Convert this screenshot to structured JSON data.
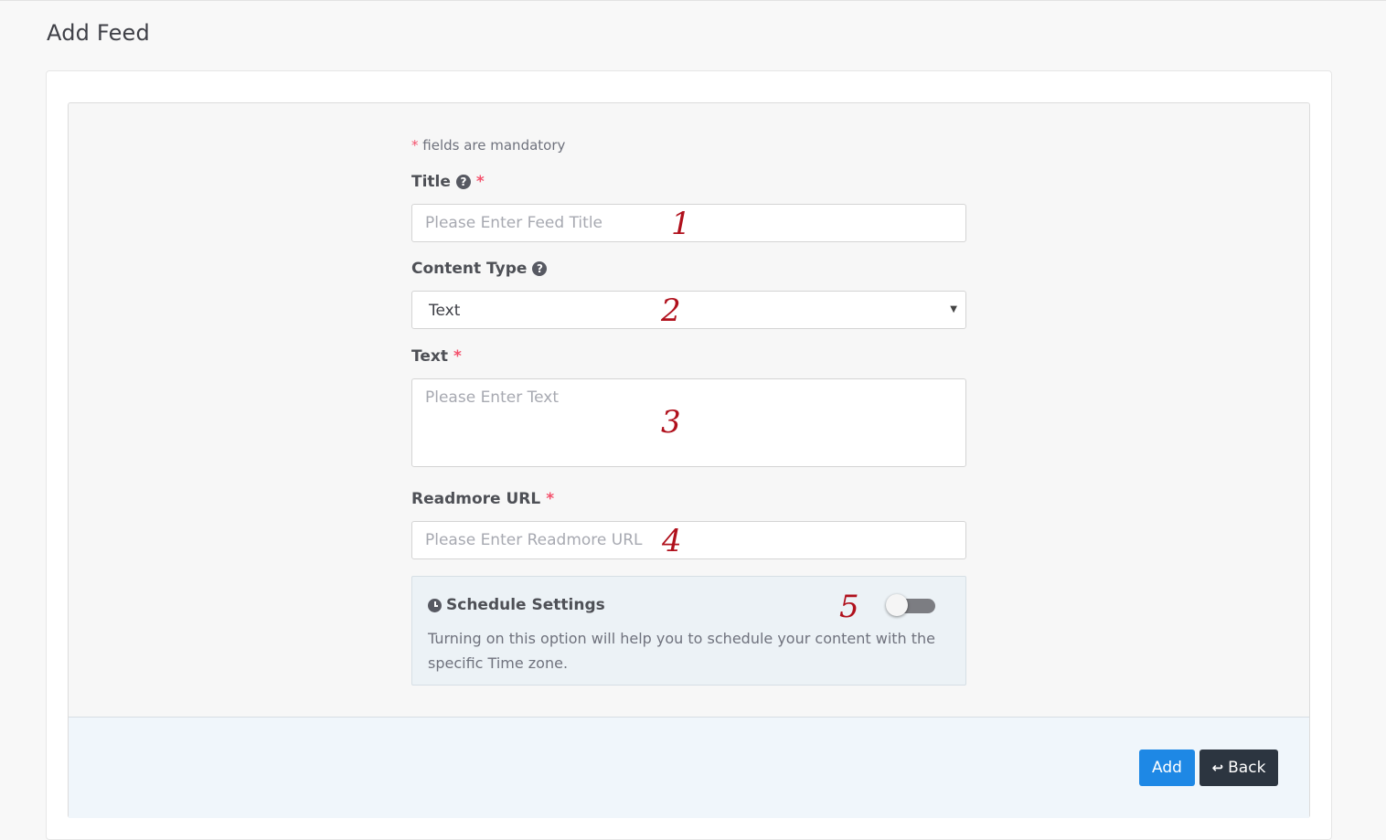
{
  "page": {
    "title": "Add Feed"
  },
  "form": {
    "mandatory_star": "*",
    "mandatory_note": "fields are mandatory",
    "title": {
      "label": "Title",
      "help_icon": "question-circle-icon",
      "required": "*",
      "placeholder": "Please Enter Feed Title",
      "value": "",
      "marker": "1"
    },
    "content_type": {
      "label": "Content Type",
      "help_icon": "question-circle-icon",
      "selected": "Text",
      "marker": "2"
    },
    "text": {
      "label": "Text",
      "required": "*",
      "placeholder": "Please Enter Text",
      "value": "",
      "marker": "3"
    },
    "readmore_url": {
      "label": "Readmore URL",
      "required": "*",
      "placeholder": "Please Enter Readmore URL",
      "value": "",
      "marker": "4"
    },
    "schedule": {
      "icon": "clock-icon",
      "title": "Schedule Settings",
      "description": "Turning on this option will help you to schedule your content with the specific Time zone.",
      "enabled": false,
      "marker": "5"
    }
  },
  "actions": {
    "add_label": "Add",
    "back_label": "Back",
    "back_icon": "return-arrow-icon"
  },
  "colors": {
    "accent": "#1e88e5",
    "required": "#f4516c",
    "back_button": "#2c3540",
    "marker": "#b0101c"
  }
}
